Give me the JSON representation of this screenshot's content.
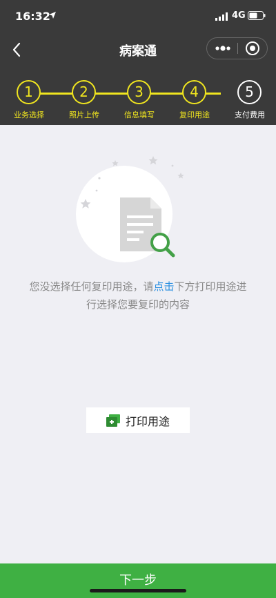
{
  "status_bar": {
    "time": "16:32",
    "network": "4G"
  },
  "nav": {
    "title": "病案通"
  },
  "steps": [
    {
      "number": "1",
      "label": "业务选择"
    },
    {
      "number": "2",
      "label": "照片上传"
    },
    {
      "number": "3",
      "label": "信息填写"
    },
    {
      "number": "4",
      "label": "复印用途"
    },
    {
      "number": "5",
      "label": "支付费用"
    }
  ],
  "empty_state": {
    "message_part1": "您没选择任何复印用途，请",
    "message_link": "点击",
    "message_part2": "下方打印用途进行选择您要复印的内容"
  },
  "print_button": {
    "label": "打印用途"
  },
  "footer": {
    "next_label": "下一步"
  },
  "colors": {
    "accent_yellow": "#f0e51f",
    "header_bg": "#3a3a3a",
    "green": "#3fb043",
    "link_blue": "#2a8fe0"
  }
}
